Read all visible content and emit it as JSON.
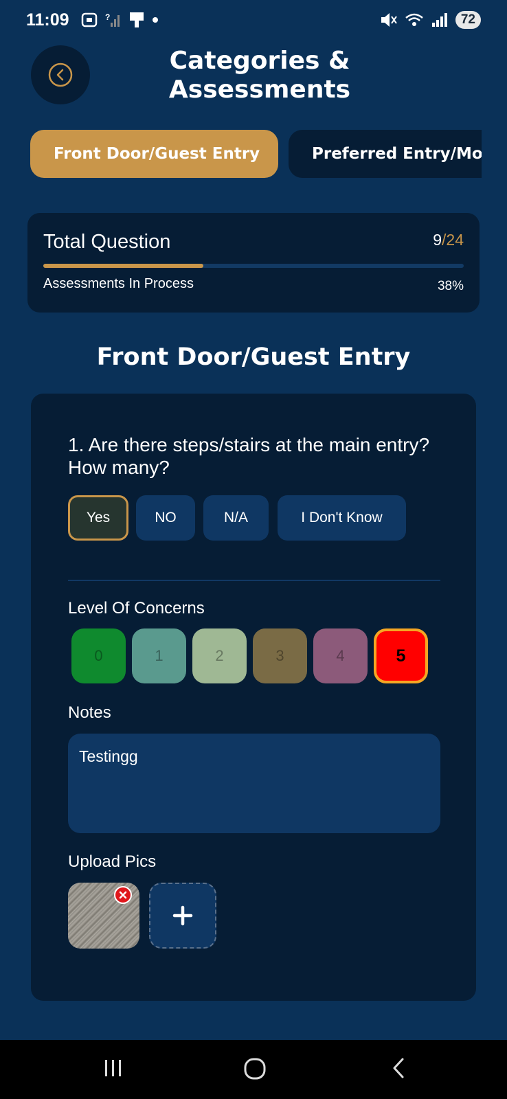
{
  "status_bar": {
    "time": "11:09",
    "battery": "72",
    "icons": [
      "screenshot-icon",
      "signal-question-icon",
      "device-icon",
      "dot-icon",
      "mute-icon",
      "wifi-icon",
      "signal-icon"
    ]
  },
  "header": {
    "title": "Categories &\nAssessments",
    "back_icon": "chevron-left-circle-icon"
  },
  "tabs": [
    {
      "label": "Front Door/Guest Entry",
      "active": true
    },
    {
      "label": "Preferred Entry/Mos",
      "active": false
    }
  ],
  "progress": {
    "label": "Total Question",
    "answered": "9",
    "separator": "/",
    "total": "24",
    "sub_label": "Assessments In Process",
    "percent_text": "38%",
    "fraction": 0.38
  },
  "section_title": "Front Door/Guest Entry",
  "question": {
    "text": "1. Are there steps/stairs at the main entry? How many?",
    "answers": [
      "Yes",
      "NO",
      "N/A",
      "I Don't Know"
    ],
    "selected_answer": "Yes"
  },
  "concern": {
    "label": "Level Of Concerns",
    "levels": [
      {
        "value": "0",
        "color": "#0f8a2e"
      },
      {
        "value": "1",
        "color": "#5a9a8e"
      },
      {
        "value": "2",
        "color": "#9fb894"
      },
      {
        "value": "3",
        "color": "#7a6b45"
      },
      {
        "value": "4",
        "color": "#8c5a7a"
      },
      {
        "value": "5",
        "color": "#ff0000"
      }
    ],
    "selected": "5"
  },
  "notes": {
    "label": "Notes",
    "value": "Testingg"
  },
  "upload": {
    "label": "Upload Pics",
    "add_icon": "plus-icon",
    "remove_icon": "close-icon"
  },
  "colors": {
    "background": "#0a3158",
    "card": "#061d35",
    "accent": "#c9964a",
    "field": "#0f3763"
  },
  "nav": [
    "recents-icon",
    "home-icon",
    "back-icon"
  ]
}
